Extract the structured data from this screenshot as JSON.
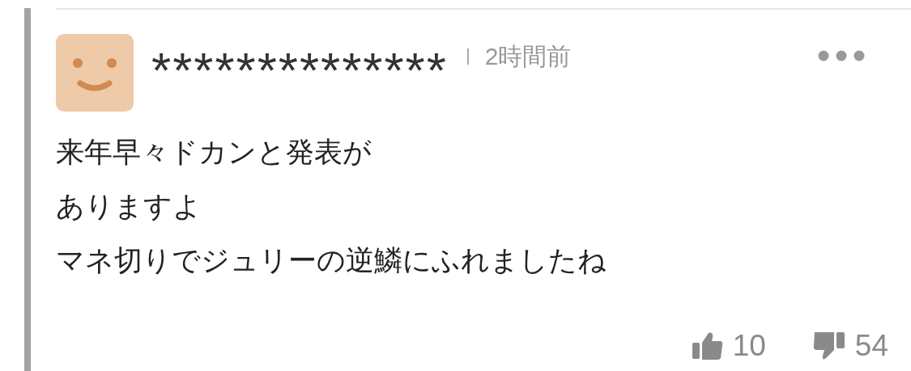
{
  "comment": {
    "user_name": "**************",
    "time": "2時間前",
    "body_lines": [
      "来年早々ドカンと発表が",
      "ありますよ",
      "マネ切りでジュリーの逆鱗にふれましたね"
    ],
    "likes": "10",
    "dislikes": "54"
  }
}
